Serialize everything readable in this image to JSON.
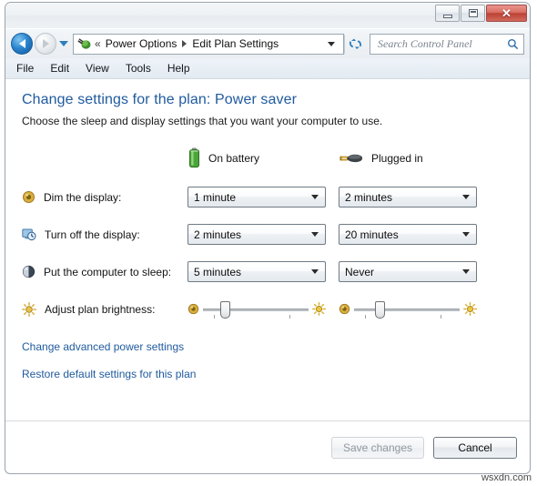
{
  "window": {
    "caption_buttons": {
      "minimize": "Minimize",
      "maximize": "Maximize",
      "close": "✕"
    }
  },
  "navbar": {
    "back_label": "Back",
    "forward_label": "Forward",
    "recent_label": "Recent pages",
    "breadcrumb_overflow": "«",
    "breadcrumbs": [
      {
        "label": "Power Options"
      },
      {
        "label": "Edit Plan Settings"
      }
    ],
    "refresh_label": "↻",
    "search": {
      "value": "",
      "placeholder": "Search Control Panel",
      "icon": "search-icon"
    }
  },
  "menubar": {
    "items": [
      {
        "label": "File"
      },
      {
        "label": "Edit"
      },
      {
        "label": "View"
      },
      {
        "label": "Tools"
      },
      {
        "label": "Help"
      }
    ]
  },
  "content": {
    "title": "Change settings for the plan: Power saver",
    "subtitle": "Choose the sleep and display settings that you want your computer to use.",
    "columns": [
      {
        "label": "On battery",
        "icon": "battery-icon"
      },
      {
        "label": "Plugged in",
        "icon": "power-plug-icon"
      }
    ],
    "rows": [
      {
        "icon": "dim-display-icon",
        "label": "Dim the display:",
        "on_battery": "1 minute",
        "plugged_in": "2 minutes"
      },
      {
        "icon": "turn-off-display-icon",
        "label": "Turn off the display:",
        "on_battery": "2 minutes",
        "plugged_in": "20 minutes"
      },
      {
        "icon": "sleep-icon",
        "label": "Put the computer to sleep:",
        "on_battery": "5 minutes",
        "plugged_in": "Never"
      }
    ],
    "brightness": {
      "icon": "brightness-sun-icon",
      "label": "Adjust plan brightness:",
      "on_battery_percent": 18,
      "plugged_in_percent": 22,
      "low_icon": "dim-brightness-icon",
      "high_icon": "bright-sun-icon"
    },
    "links": [
      {
        "label": "Change advanced power settings"
      },
      {
        "label": "Restore default settings for this plan"
      }
    ]
  },
  "footer": {
    "save_label": "Save changes",
    "save_enabled": false,
    "cancel_label": "Cancel"
  },
  "watermark": "wsxdn.com",
  "colors": {
    "title_blue": "#1f5a9e",
    "link_blue": "#1f5a9e",
    "close_red": "#bb4133",
    "battery_green": "#4aa53a"
  }
}
